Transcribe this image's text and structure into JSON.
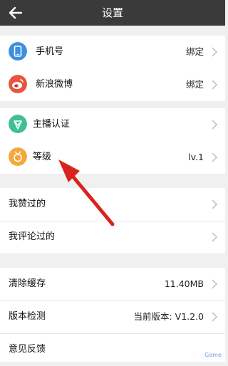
{
  "header": {
    "title": "设置"
  },
  "colors": {
    "topbar": "#3a3a3a",
    "phone_icon": "#3d8fe0",
    "weibo_icon": "#e8543f",
    "anchor_icon": "#3fbf93",
    "level_icon": "#f4a73b",
    "arrow": "#d8241f"
  },
  "account": {
    "items": [
      {
        "label": "手机号",
        "value": "绑定",
        "icon": "phone-icon"
      },
      {
        "label": "新浪微博",
        "value": "绑定",
        "icon": "weibo-icon"
      }
    ]
  },
  "profile": {
    "items": [
      {
        "label": "主播认证",
        "value": "",
        "icon": "verify-icon"
      },
      {
        "label": "等级",
        "value": "lv.1",
        "icon": "level-icon"
      }
    ]
  },
  "history": {
    "items": [
      {
        "label": "我赞过的"
      },
      {
        "label": "我评论过的"
      }
    ]
  },
  "system": {
    "items": [
      {
        "label": "清除缓存",
        "value": "11.40MB"
      },
      {
        "label": "版本检测",
        "value": "当前版本: V1.2.0"
      },
      {
        "label": "意见反馈"
      }
    ]
  },
  "watermark": "Game"
}
